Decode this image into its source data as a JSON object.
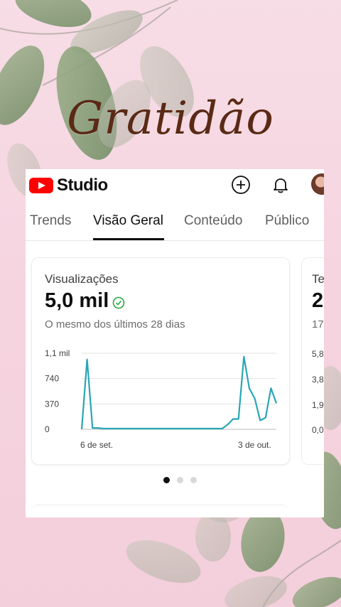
{
  "overlay": {
    "title": "Gratidão"
  },
  "app": {
    "name": "Studio"
  },
  "tabs": [
    {
      "label": "Trends",
      "active": false
    },
    {
      "label": "Visão Geral",
      "active": true
    },
    {
      "label": "Conteúdo",
      "active": false
    },
    {
      "label": "Público",
      "active": false
    }
  ],
  "card_primary": {
    "label": "Visualizações",
    "value": "5,0 mil",
    "comparison": "O mesmo dos últimos 28 dias"
  },
  "card_secondary": {
    "label": "Te",
    "value": "2",
    "sub": "17",
    "ticks": [
      "5,8",
      "3,8",
      "1,9",
      "0,0"
    ]
  },
  "carousel": {
    "pages": 3,
    "active": 0
  },
  "colors": {
    "accent": "#2aa6b5",
    "brand": "#ff0000",
    "check": "#2ba640"
  },
  "chart_data": {
    "type": "line",
    "series": [
      {
        "values": [
          0,
          1020,
          20,
          20,
          10,
          10,
          10,
          10,
          10,
          10,
          10,
          10,
          10,
          10,
          10,
          10,
          10,
          10,
          10,
          10,
          10,
          10,
          10,
          10,
          10,
          10,
          10,
          70,
          150,
          150,
          1060,
          600,
          450,
          130,
          170,
          600,
          380
        ]
      }
    ],
    "x_tick_labels": [
      "6 de set.",
      "3 de out."
    ],
    "y_tick_labels": [
      "1,1 mil",
      "740",
      "370",
      "0"
    ],
    "ylim": [
      0,
      1110
    ],
    "grid": true
  }
}
